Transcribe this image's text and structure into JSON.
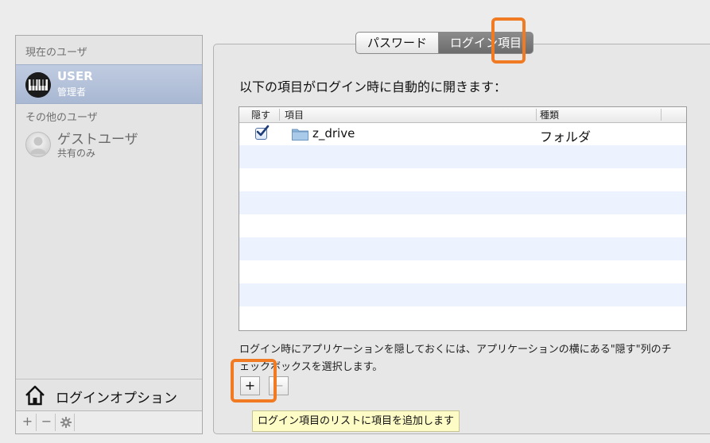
{
  "sidebar": {
    "current_users_header": "現在のユーザ",
    "current_user": {
      "name": "USER",
      "role": "管理者",
      "avatar_icon": "piano-keys-icon"
    },
    "other_users_header": "その他のユーザ",
    "guest_user": {
      "name": "ゲストユーザ",
      "role": "共有のみ",
      "avatar_icon": "guest-silhouette-icon"
    },
    "login_options_label": "ログインオプション",
    "toolbar": {
      "add": "+",
      "remove": "−",
      "action_icon": "gear-icon"
    }
  },
  "tabs": [
    {
      "label": "パスワード",
      "selected": false
    },
    {
      "label": "ログイン項目",
      "selected": true
    }
  ],
  "heading": "以下の項目がログイン時に自動的に開きます：",
  "table": {
    "columns": [
      "隠す",
      "項目",
      "種類"
    ],
    "rows": [
      {
        "hide": true,
        "item": "z_drive",
        "kind": "フォルダ",
        "icon": "folder-icon"
      }
    ]
  },
  "hint": "ログイン時にアプリケーションを隠しておくには、アプリケーションの横にある\"隠す\"列のチェックボックスを選択します。",
  "buttons": {
    "add": "+",
    "remove": "−"
  },
  "tooltip": "ログイン項目のリストに項目を追加します",
  "colors": {
    "highlight": "#f07b22",
    "selection": "#a9b8d3",
    "tooltip_bg": "#fdfcc7"
  }
}
